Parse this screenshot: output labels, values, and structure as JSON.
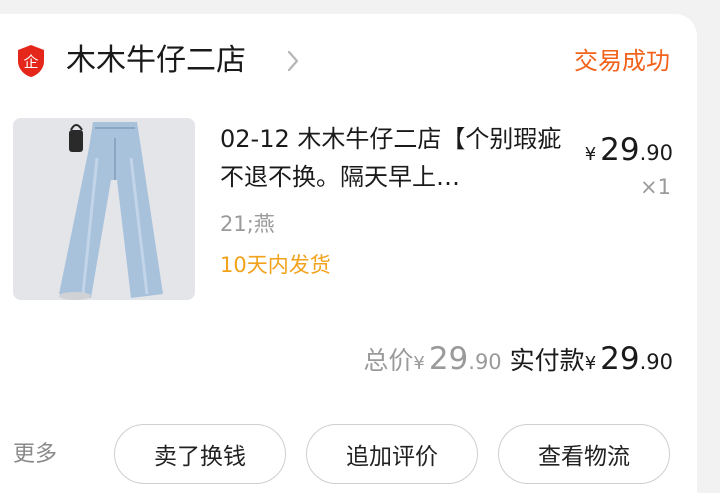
{
  "shop": {
    "name": "木木牛仔二店",
    "badge_icon": "enterprise-shield-icon",
    "badge_glyph": "企",
    "badge_color": "#e5261b"
  },
  "order": {
    "status": "交易成功",
    "status_color": "#f2621b"
  },
  "product": {
    "title": "02-12 木木牛仔二店【个别瑕疵不退不换。隔天早上…",
    "sku": "21;燕",
    "shipping": "10天内发货",
    "price": {
      "currency": "¥",
      "integer": "29",
      "decimal": ".90"
    },
    "quantity": "×1"
  },
  "totals": {
    "total_label": "总价",
    "total": {
      "currency": "¥",
      "integer": "29",
      "decimal": ".90"
    },
    "paid_label": "实付款",
    "paid": {
      "currency": "¥",
      "integer": "29",
      "decimal": ".90"
    }
  },
  "actions": {
    "more": "更多",
    "buttons": [
      "卖了换钱",
      "追加评价",
      "查看物流"
    ]
  }
}
